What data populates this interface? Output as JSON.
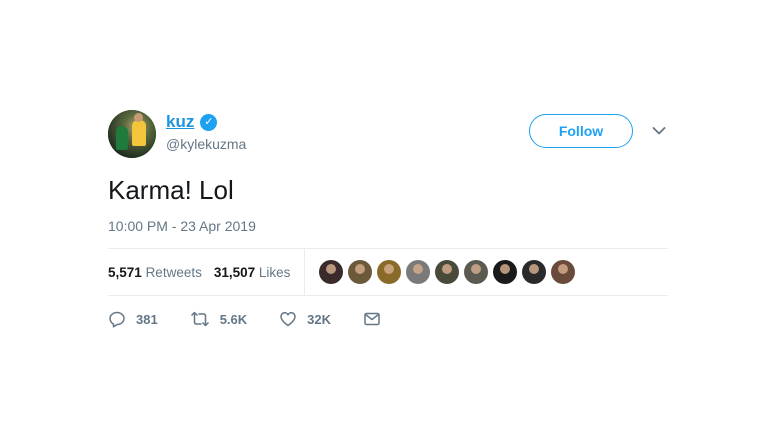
{
  "user": {
    "display_name": "kuz",
    "handle": "@kylekuzma",
    "verified": true
  },
  "follow_button": {
    "label": "Follow"
  },
  "tweet": {
    "text": "Karma! Lol",
    "timestamp": "10:00 PM - 23 Apr 2019"
  },
  "stats": {
    "retweets_count": "5,571",
    "retweets_label": "Retweets",
    "likes_count": "31,507",
    "likes_label": "Likes"
  },
  "likers": [
    {
      "color": "#3a2a2a"
    },
    {
      "color": "#6b5a3a"
    },
    {
      "color": "#8a6a2a"
    },
    {
      "color": "#7a7a7a"
    },
    {
      "color": "#4a4a3a"
    },
    {
      "color": "#5a5a50"
    },
    {
      "color": "#1a1a1a"
    },
    {
      "color": "#2a2a2a"
    },
    {
      "color": "#6a4a3a"
    }
  ],
  "actions": {
    "reply_count": "381",
    "retweet_count": "5.6K",
    "like_count": "32K"
  },
  "icons": {
    "reply": "reply-icon",
    "retweet": "retweet-icon",
    "like": "heart-icon",
    "dm": "envelope-icon",
    "more": "chevron-down-icon",
    "verified": "verified-badge-icon"
  },
  "colors": {
    "accent": "#1da1f2",
    "link": "#1b95e0",
    "secondary_text": "#657786",
    "divider": "#e6ecf0"
  }
}
